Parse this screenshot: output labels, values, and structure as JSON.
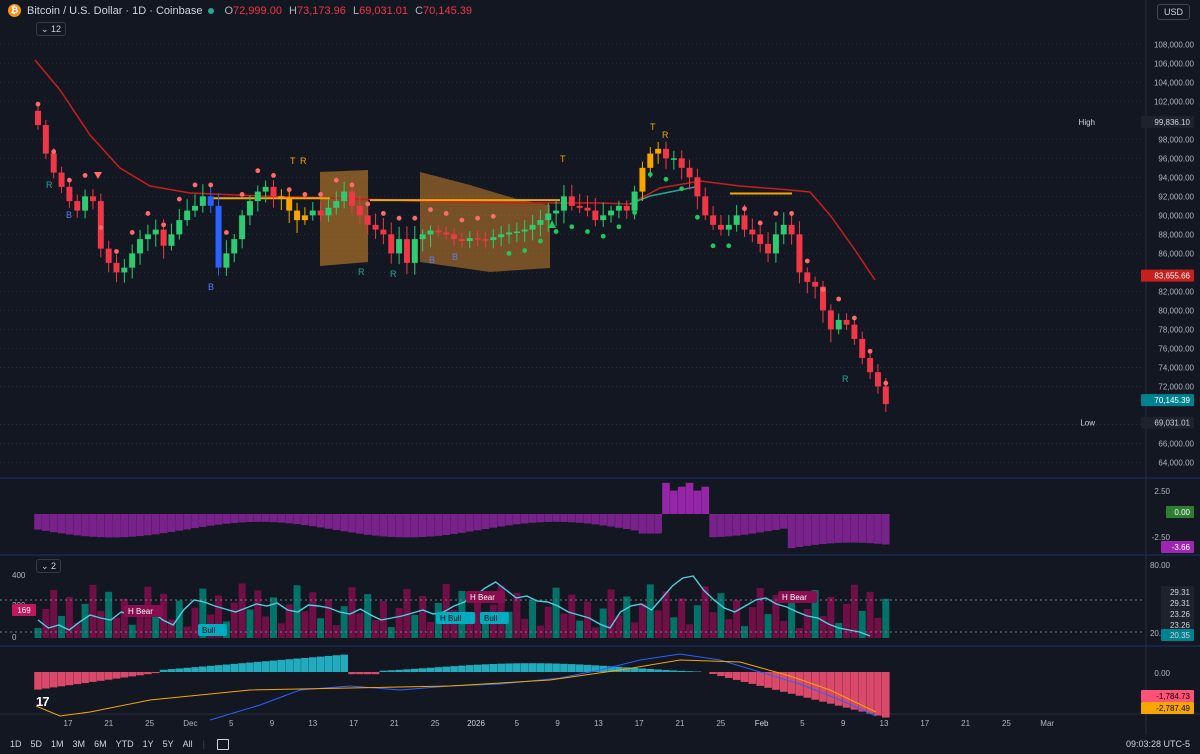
{
  "header": {
    "symbol_title": "Bitcoin / U.S. Dollar · 1D · Coinbase",
    "coin_glyph": "₿",
    "o_label": "O",
    "o_value": "72,999.00",
    "h_label": "H",
    "h_value": "73,173.96",
    "l_label": "L",
    "l_value": "69,031.01",
    "c_label": "C",
    "c_value": "70,145.39"
  },
  "collapse_labels": {
    "main": "12",
    "osc": "2"
  },
  "currency": "USD",
  "price_axis": [
    "108,000.00",
    "106,000.00",
    "104,000.00",
    "102,000.00",
    "98,000.00",
    "96,000.00",
    "94,000.00",
    "92,000.00",
    "90,000.00",
    "88,000.00",
    "86,000.00",
    "84,000.00",
    "82,000.00",
    "80,000.00",
    "78,000.00",
    "76,000.00",
    "74,000.00",
    "72,000.00",
    "68,000.00",
    "66,000.00",
    "64,000.00"
  ],
  "price_badges": {
    "high_label": "High",
    "high_value": "99,836.10",
    "ma_value": "83,655.66",
    "last_value": "70,145.39",
    "low_label": "Low",
    "low_value": "69,031.01"
  },
  "pane1_axis": [
    "2.50",
    "-2.50"
  ],
  "pane1_badges": {
    "v1": "0.00",
    "v2": "-3.66"
  },
  "pane2_axis": [
    "80.00",
    "20.00"
  ],
  "pane2_left_axis": [
    "400",
    "200",
    "0"
  ],
  "pane2_badges": [
    "29.31",
    "29.31",
    "23.26",
    "23.26",
    "20.35"
  ],
  "pane2_left_badge": "169",
  "pane2_labels": [
    {
      "text": "H Bear",
      "kind": "bear"
    },
    {
      "text": "Bull",
      "kind": "bull"
    },
    {
      "text": "H Bull",
      "kind": "bull"
    },
    {
      "text": "Bull",
      "kind": "bull"
    },
    {
      "text": "H Bear",
      "kind": "bear"
    },
    {
      "text": "H Bear",
      "kind": "bear"
    }
  ],
  "pane3_axis": [
    "0.00"
  ],
  "pane3_badges": {
    "v1": "-1,784.73",
    "v2": "-2,787.49"
  },
  "time_axis": [
    "17",
    "21",
    "25",
    "Dec",
    "5",
    "9",
    "13",
    "17",
    "21",
    "25",
    "2026",
    "5",
    "9",
    "13",
    "17",
    "21",
    "25",
    "Feb",
    "5",
    "9",
    "13",
    "17",
    "21",
    "25",
    "Mar"
  ],
  "timeframes": [
    "1D",
    "5D",
    "1M",
    "3M",
    "6M",
    "YTD",
    "1Y",
    "5Y",
    "All"
  ],
  "clock": "09:03:28 UTC-5",
  "signal_letters": [
    "R",
    "B",
    "B",
    "T",
    "R",
    "R",
    "R",
    "B",
    "B",
    "T",
    "T",
    "R",
    "R"
  ],
  "colors": {
    "bull": "#26a69a",
    "bear": "#f23645",
    "candle_up": "#2ecc71",
    "ma": "#c81e1e",
    "pivot": "#f7a600",
    "cloud": "#d98c2b",
    "hist": "#9c27b0",
    "rsi": "#4dd0e1",
    "macd_up": "#26c6da",
    "macd_down": "#ff5277"
  },
  "chart_data": {
    "type": "candlestick",
    "symbol": "Bitcoin / U.S. Dollar",
    "interval": "1D",
    "ylim": [
      63000,
      109500
    ],
    "close": [
      99500,
      96500,
      94500,
      93000,
      91500,
      90500,
      92000,
      91500,
      86500,
      85000,
      84000,
      84500,
      86000,
      87500,
      88000,
      88500,
      86800,
      88000,
      89500,
      90500,
      91000,
      92000,
      91000,
      84500,
      86000,
      87500,
      90000,
      91500,
      92500,
      93000,
      92000,
      91800,
      90500,
      89500,
      90000,
      90500,
      90000,
      90800,
      91500,
      92500,
      91000,
      90000,
      89000,
      88500,
      88000,
      86000,
      87500,
      85000,
      87500,
      88000,
      88400,
      88200,
      88000,
      87500,
      87300,
      87600,
      87500,
      87400,
      87700,
      88000,
      88200,
      88300,
      88500,
      89000,
      89500,
      90200,
      90500,
      92000,
      91000,
      90800,
      90500,
      89500,
      90000,
      90500,
      91000,
      90500,
      92500,
      95000,
      96500,
      97000,
      96000,
      96000,
      95000,
      94000,
      92000,
      90000,
      89000,
      88500,
      89000,
      90000,
      88500,
      88000,
      87000,
      86000,
      88000,
      89000,
      88000,
      84000,
      83000,
      82500,
      80000,
      78000,
      79000,
      78500,
      77000,
      75000,
      73500,
      72000,
      70145
    ]
  }
}
